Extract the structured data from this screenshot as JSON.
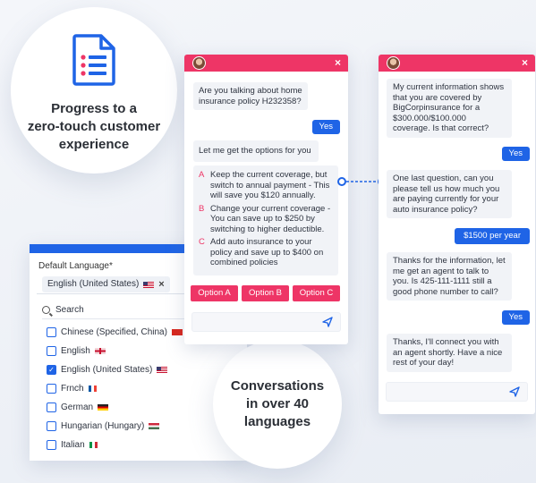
{
  "promo": {
    "progress_title": [
      "Progress to a",
      "zero-touch customer",
      "experience"
    ],
    "languages_title": [
      "Conversations",
      "in over 40",
      "languages"
    ]
  },
  "language_panel": {
    "label": "Default Language*",
    "selected_chip": "English (United States)",
    "chip_flag_icon": "us-flag-icon",
    "chip_close": "×",
    "search_label": "Search",
    "items": [
      {
        "label": "Chinese (Specified, China)",
        "checked": false,
        "flag": "china-flag-icon",
        "flag_color": "#d9261c"
      },
      {
        "label": "English",
        "checked": false,
        "flag": "uk-flag-icon",
        "flag_color": "#c8102e"
      },
      {
        "label": "English (United States)",
        "checked": true,
        "flag": "us-flag-icon",
        "flag_color": "#3c3b6e"
      },
      {
        "label": "Frnch",
        "checked": false,
        "flag": "france-flag-icon",
        "flag_color": "#0055a4"
      },
      {
        "label": "German",
        "checked": false,
        "flag": "germany-flag-icon",
        "flag_color": "#ffce00"
      },
      {
        "label": "Hungarian (Hungary)",
        "checked": false,
        "flag": "hungary-flag-icon",
        "flag_color": "#477050"
      },
      {
        "label": "Italian",
        "checked": false,
        "flag": "italy-flag-icon",
        "flag_color": "#009246"
      }
    ]
  },
  "chat_left": {
    "q1": "Are you talking about home insurance policy H232358?",
    "a1": "Yes",
    "q2": "Let me get the options for you",
    "options": [
      {
        "letter": "A",
        "text": "Keep the current coverage, but switch to annual payment - This will save you $120 annually."
      },
      {
        "letter": "B",
        "text": "Change your current coverage - You can save up to $250 by switching to higher deductible."
      },
      {
        "letter": "C",
        "text": "Add auto insurance to your policy and save up to $400 on combined policies"
      }
    ],
    "buttons": [
      "Option A",
      "Option B",
      "Option C"
    ]
  },
  "chat_right": {
    "m1": "My current information shows that you are covered by BigCorpinsurance for a $300.000/$100.000 coverage. Is that correct?",
    "r1": "Yes",
    "m2": "One last question, can you please tell us how much you are paying currently for your auto insurance policy?",
    "r2": "$1500 per year",
    "m3": "Thanks for the information, let me get an agent to talk to you. Is 425-111-1111 still a good phone number to call?",
    "r3": "Yes",
    "m4": "Thanks, I'll connect you with an agent shortly. Have a nice rest of your day!"
  },
  "colors": {
    "accent_blue": "#1f64e6",
    "accent_pink": "#ee3566"
  }
}
